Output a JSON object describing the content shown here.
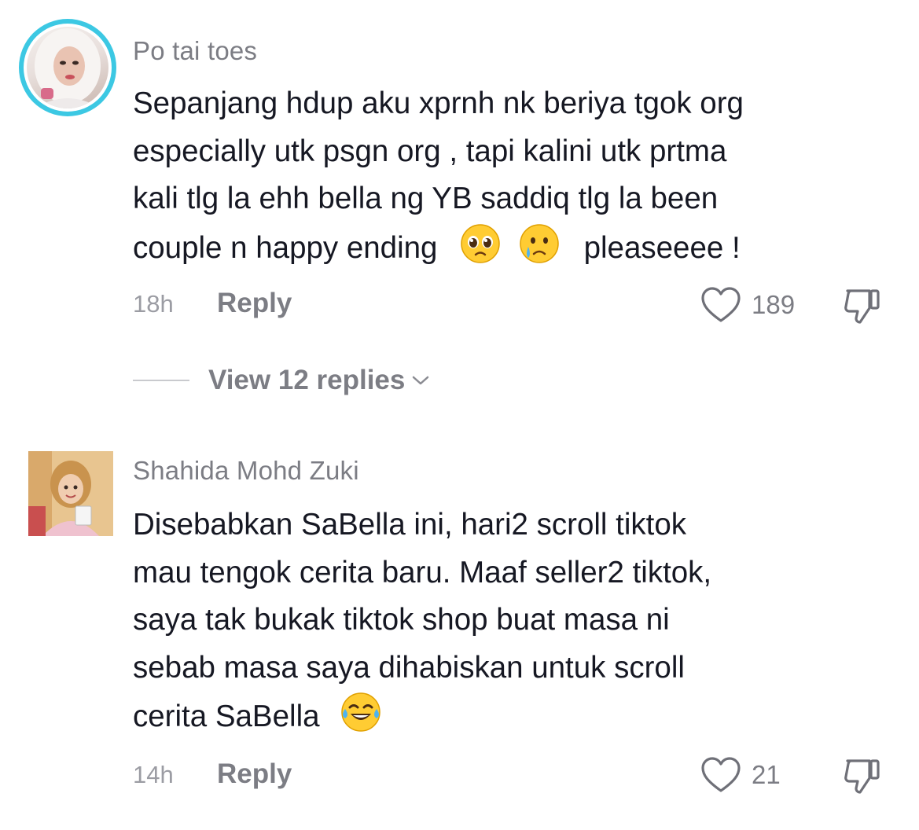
{
  "comments": [
    {
      "username": "Po tai toes",
      "lines": [
        "Sepanjang hdup aku xprnh nk beriya tgok org",
        "especially utk psgn org , tapi kalini utk prtma",
        "kali tlg la ehh bella ng YB saddiq tlg la been",
        "couple n happy ending",
        "pleaseeee !"
      ],
      "emojis": [
        "pleading-face-emoji",
        "crying-face-emoji"
      ],
      "time": "18h",
      "reply_label": "Reply",
      "likes": "189",
      "view_replies": "View 12 replies"
    },
    {
      "username": "Shahida Mohd Zuki",
      "lines": [
        "Disebabkan SaBella ini, hari2 scroll tiktok",
        "mau tengok cerita baru. Maaf seller2 tiktok,",
        "saya tak bukak tiktok shop buat masa ni",
        "sebab masa saya dihabiskan untuk scroll",
        "cerita SaBella"
      ],
      "emojis": [
        "tears-of-joy-emoji"
      ],
      "time": "14h",
      "reply_label": "Reply",
      "likes": "21"
    }
  ],
  "colors": {
    "story_ring": "#3cc8e3",
    "text_primary": "#161823",
    "text_secondary": "#7c7d84"
  }
}
